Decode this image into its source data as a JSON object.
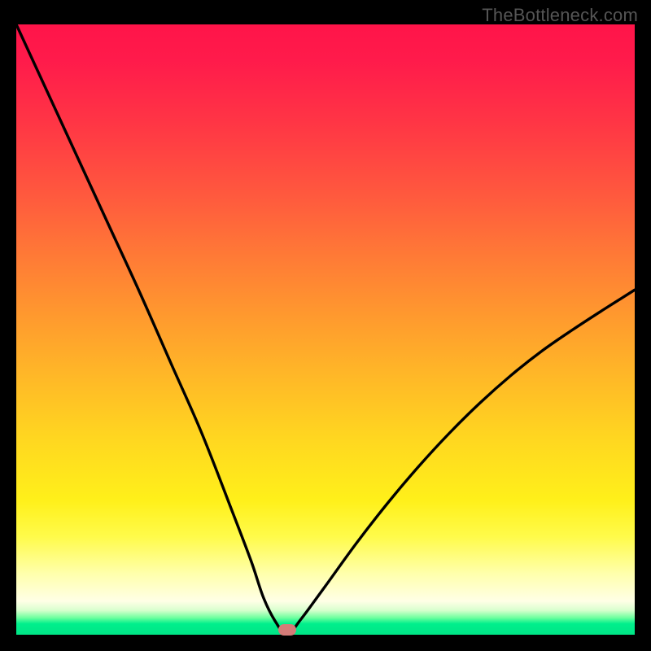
{
  "watermark": "TheBottleneck.com",
  "colors": {
    "frame": "#000000",
    "curve": "#000000",
    "marker": "#d47b78",
    "gradient_top": "#ff1449",
    "gradient_bottom": "#00e586"
  },
  "chart_data": {
    "type": "line",
    "title": "",
    "xlabel": "",
    "ylabel": "",
    "xlim": [
      0,
      100
    ],
    "ylim": [
      0,
      100
    ],
    "annotations": [
      "TheBottleneck.com"
    ],
    "grid": false,
    "series": [
      {
        "name": "bottleneck-curve",
        "x": [
          0,
          5,
          10,
          15,
          20,
          25,
          30,
          35,
          38,
          40,
          42,
          43.8,
          46,
          50,
          55,
          60,
          65,
          70,
          75,
          80,
          85,
          90,
          95,
          100
        ],
        "y": [
          100,
          89,
          78,
          67,
          56,
          44.5,
          33,
          20,
          12,
          6,
          2,
          0,
          2.5,
          8,
          15,
          21.5,
          27.5,
          33,
          38,
          42.5,
          46.5,
          50,
          53.3,
          56.5
        ]
      }
    ],
    "marker": {
      "x": 43.8,
      "y": 0.8
    }
  }
}
